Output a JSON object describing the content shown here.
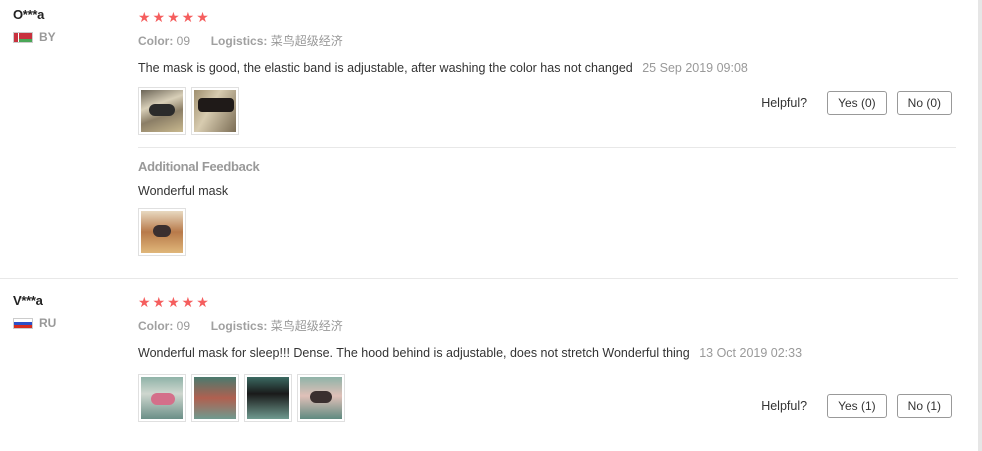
{
  "reviews": [
    {
      "user": "O***a",
      "country": "BY",
      "stars": "★★★★★",
      "color_label": "Color:",
      "color_value": "09",
      "logistics_label": "Logistics:",
      "logistics_value": "菜鸟超级经济",
      "text": "The mask is good, the elastic band is adjustable, after washing the color has not changed",
      "date": "25 Sep 2019 09:08",
      "helpful_label": "Helpful?",
      "yes": "Yes (0)",
      "no": "No (0)",
      "additional_title": "Additional Feedback",
      "additional_text": "Wonderful mask"
    },
    {
      "user": "V***a",
      "country": "RU",
      "stars": "★★★★★",
      "color_label": "Color:",
      "color_value": "09",
      "logistics_label": "Logistics:",
      "logistics_value": "菜鸟超级经济",
      "text": "Wonderful mask for sleep!!! Dense. The hood behind is adjustable, does not stretch Wonderful thing",
      "date": "13 Oct 2019 02:33",
      "helpful_label": "Helpful?",
      "yes": "Yes (1)",
      "no": "No (1)"
    }
  ],
  "colors": {
    "star": "#f55e5e",
    "muted": "#999999",
    "border": "#e8e8e8"
  }
}
